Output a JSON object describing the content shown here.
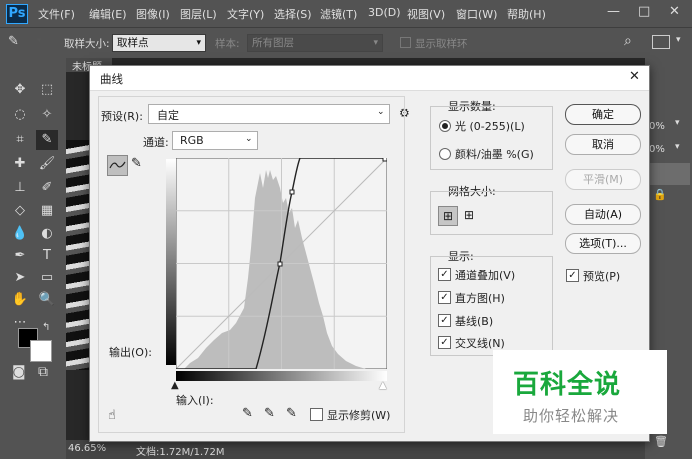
{
  "app": {
    "logo": "Ps"
  },
  "menubar": {
    "items": [
      "文件(F)",
      "编辑(E)",
      "图像(I)",
      "图层(L)",
      "文字(Y)",
      "选择(S)",
      "滤镜(T)",
      "3D(D)",
      "视图(V)",
      "窗口(W)",
      "帮助(H)"
    ]
  },
  "window_controls": {
    "minimize": "—",
    "maximize": "□",
    "close": "✕"
  },
  "options_bar": {
    "sample_size_label": "取样大小:",
    "sample_size_value": "取样点",
    "sample_label": "样本:",
    "sample_value": "所有图层",
    "show_ring_label": "显示取样环"
  },
  "document": {
    "tab_title": "未标题"
  },
  "status": {
    "zoom": "46.65%",
    "doc_info": "文档:1.72M/1.72M"
  },
  "side_panel": {
    "percent_1": "0%",
    "percent_2": "0%"
  },
  "dialog": {
    "title": "曲线",
    "close": "✕",
    "preset_label": "预设(R):",
    "preset_value": "自定",
    "channel_label": "通道:",
    "channel_value": "RGB",
    "output_label": "输出(O):",
    "input_label": "输入(I):",
    "show_clipping_label": "显示修剪(W)",
    "show_amount": {
      "title": "显示数量:",
      "light": "光 (0-255)(L)",
      "pigment": "颜料/油墨 %(G)",
      "selected": "light"
    },
    "grid_size": {
      "title": "网格大小:"
    },
    "display": {
      "title": "显示:",
      "items": [
        {
          "label": "通道叠加(V)",
          "checked": true
        },
        {
          "label": "直方图(H)",
          "checked": true
        },
        {
          "label": "基线(B)",
          "checked": true
        },
        {
          "label": "交叉线(N)",
          "checked": true
        }
      ]
    },
    "buttons": {
      "ok": "确定",
      "cancel": "取消",
      "smooth": "平滑(M)",
      "auto": "自动(A)",
      "options": "选项(T)..."
    },
    "preview": {
      "label": "预览(P)",
      "checked": true
    }
  },
  "watermark": {
    "title": "百科全说",
    "subtitle": "助你轻松解决"
  },
  "colors": {
    "accent_green": "#19a83c",
    "ps_blue": "#31a8ff"
  }
}
